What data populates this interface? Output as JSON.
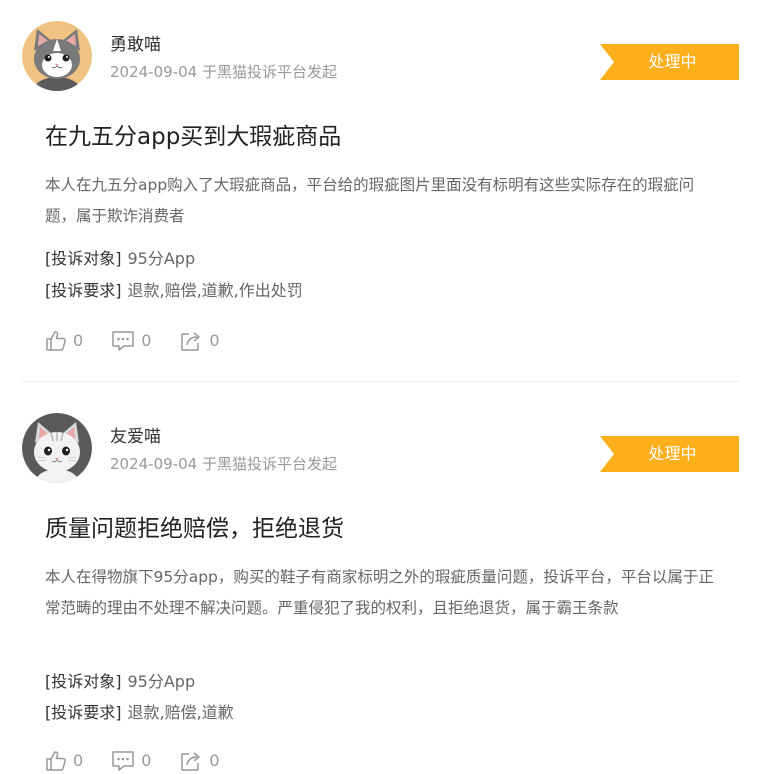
{
  "complaints": [
    {
      "username": "勇敢喵",
      "date": "2024-09-04",
      "source": "于黑猫投诉平台发起",
      "status": "处理中",
      "title": "在九五分app买到大瑕疵商品",
      "description": "本人在九五分app购入了大瑕疵商品，平台给的瑕疵图片里面没有标明有这些实际存在的瑕疵问题，属于欺诈消费者",
      "target_label": "[投诉对象]",
      "target_value": "95分App",
      "request_label": "[投诉要求]",
      "request_value": "退款,赔偿,道歉,作出处罚",
      "likes": "0",
      "comments": "0",
      "shares": "0",
      "avatar_icon": "gray-cat-avatar"
    },
    {
      "username": "友爱喵",
      "date": "2024-09-04",
      "source": "于黑猫投诉平台发起",
      "status": "处理中",
      "title": "质量问题拒绝赔偿，拒绝退货",
      "description": "本人在得物旗下95分app，购买的鞋子有商家标明之外的瑕疵质量问题，投诉平台，平台以属于正常范畴的理由不处理不解决问题。严重侵犯了我的权利，且拒绝退货，属于霸王条款",
      "target_label": "[投诉对象]",
      "target_value": "95分App",
      "request_label": "[投诉要求]",
      "request_value": "退款,赔偿,道歉",
      "likes": "0",
      "comments": "0",
      "shares": "0",
      "avatar_icon": "white-cat-avatar"
    }
  ],
  "colors": {
    "status_badge": "#fcae1b",
    "meta_text": "#999999",
    "body_text": "#666666"
  }
}
